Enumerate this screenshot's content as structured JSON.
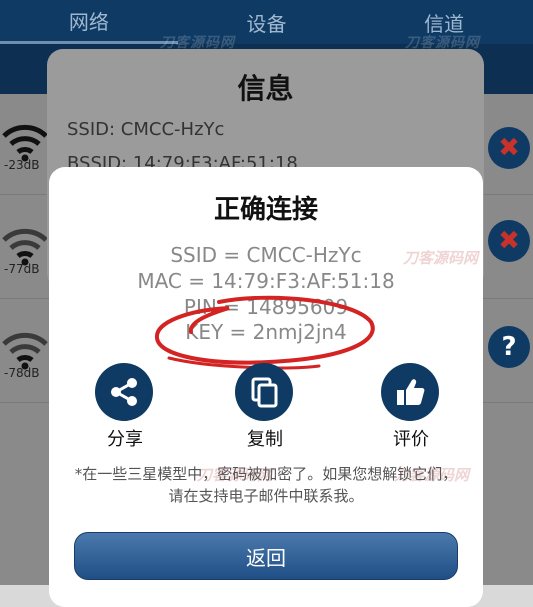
{
  "tabs": [
    "网络",
    "设备",
    "信道"
  ],
  "watermark": "刀客源码网",
  "networks": [
    {
      "signal": "-23dB",
      "action": "remove"
    },
    {
      "signal": "-77dB",
      "action": "remove"
    },
    {
      "signal": "-78dB",
      "action": "help"
    }
  ],
  "info_dialog": {
    "title": "信息",
    "ssid_line": "SSID: CMCC-HzYc",
    "bssid_line": "BSSID: 14:79:F3:AF:51:18"
  },
  "connect_dialog": {
    "title": "正确连接",
    "ssid": "SSID = CMCC-HzYc",
    "mac": "MAC = 14:79:F3:AF:51:18",
    "pin": "PIN = 14895609",
    "key": "KEY = 2nmj2jn4",
    "actions": [
      {
        "label": "分享",
        "icon": "share-icon"
      },
      {
        "label": "复制",
        "icon": "copy-icon"
      },
      {
        "label": "评价",
        "icon": "thumbs-up-icon"
      }
    ],
    "note": "*在一些三星模型中，密码被加密了。如果您想解锁它们，请在支持电子邮件中联系我。",
    "back_button": "返回"
  },
  "colors": {
    "primary": "#0f3a63",
    "danger": "#c8322a",
    "annotation": "#d42323"
  }
}
